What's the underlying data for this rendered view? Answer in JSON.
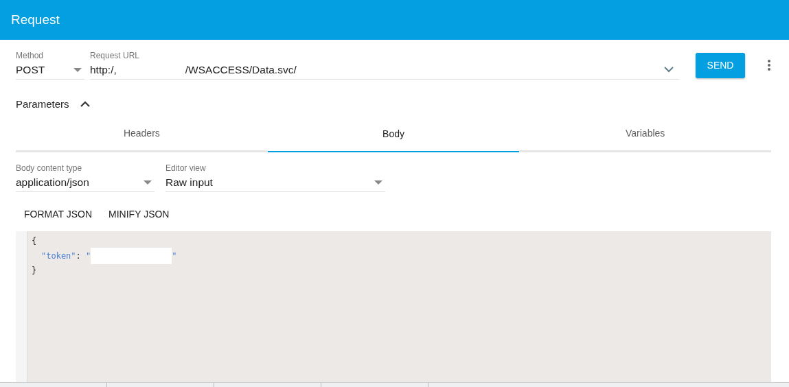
{
  "header": {
    "title": "Request"
  },
  "method": {
    "label": "Method",
    "value": "POST"
  },
  "url": {
    "label": "Request URL",
    "value_start": "http:/,",
    "value_end": "/WSACCESS/Data.svc/"
  },
  "send_button": "SEND",
  "parameters": {
    "label": "Parameters",
    "expanded": true
  },
  "tabs": [
    {
      "label": "Headers",
      "selected": false
    },
    {
      "label": "Body",
      "selected": true
    },
    {
      "label": "Variables",
      "selected": false
    }
  ],
  "body_content_type": {
    "label": "Body content type",
    "value": "application/json"
  },
  "editor_view": {
    "label": "Editor view",
    "value": "Raw input"
  },
  "actions": [
    "FORMAT JSON",
    "MINIFY JSON"
  ],
  "code_lines": [
    [
      {
        "kind": "punct",
        "text": "{"
      }
    ],
    [
      {
        "kind": "key",
        "text": "\"token\""
      },
      {
        "kind": "punct",
        "text": ": "
      },
      {
        "kind": "string",
        "text": "\""
      },
      {
        "kind": "redacted"
      },
      {
        "kind": "string",
        "text": "\""
      }
    ],
    [
      {
        "kind": "punct",
        "text": "}"
      }
    ]
  ]
}
